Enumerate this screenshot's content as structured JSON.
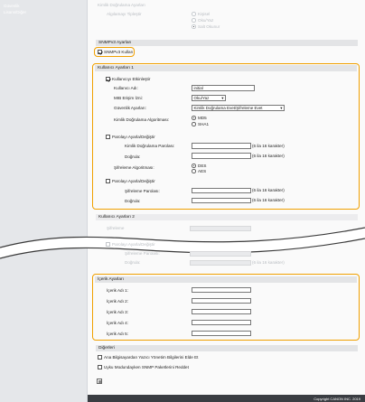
{
  "sidebar": {
    "items": [
      "Güvenlik",
      "Lisans/Diğer"
    ]
  },
  "top_faded": {
    "section": "Kimlik Doğrulama Ayarları",
    "row_label": "Algılamayı Tipleştir",
    "options": [
      "Kişisel",
      "Oku/Yaz",
      "Salt Okunur"
    ]
  },
  "snmpv3": {
    "header": "SNMPv3 Ayarları",
    "enable_label": "SNMPv3 Kullan",
    "enable_checked": true
  },
  "user1": {
    "header": "Kullanıcı Ayarları 1",
    "enable_label": "Kullanıcıyı Etkinleştir",
    "enable_checked": true,
    "username_label": "Kullanıcı Adı:",
    "username_value": "initial",
    "mib_label": "MIB Erişim İzni:",
    "mib_value": "Oku/Yaz",
    "security_label": "Güvenlik Ayarları:",
    "security_value": "Kimlik Doğrulama Evet/Şifreleme Evet",
    "auth_algo_label": "Kimlik Doğrulama Algoritması:",
    "auth_algo_options": [
      "MD5",
      "SHA1"
    ],
    "auth_algo_selected": 0,
    "set_pw_label": "Parolayı Ayarla/Değiştir",
    "auth_pw_label": "Kimlik Doğrulama Parolası:",
    "auth_pw_hint": "(6 ila 16 karakter)",
    "confirm_label": "Doğrula:",
    "confirm_hint": "(6 ila 16 karakter)",
    "enc_algo_label": "Şifreleme Algoritması:",
    "enc_algo_options": [
      "DES",
      "AES"
    ],
    "enc_algo_selected": 0,
    "set_pw2_label": "Parolayı Ayarla/Değiştir",
    "enc_pw_label": "Şifreleme Parolası:",
    "enc_pw_hint": "(6 ila 16 karakter)",
    "confirm2_label": "Doğrula:",
    "confirm2_hint": "(6 ila 16 karakter)"
  },
  "user2": {
    "header": "Kullanıcı Ayarları 2",
    "row1": "Şifreleme",
    "set_pw_label": "Parolayı Ayarla/Değiştir",
    "enc_pw_label": "Şifreleme Parolası:",
    "confirm_label": "Doğrula:",
    "confirm_hint": "(6 ila 16 karakter)"
  },
  "context": {
    "header": "İçerik Ayarları",
    "labels": [
      "İçerik Adı 1:",
      "İçerik Adı 2:",
      "İçerik Adı 3:",
      "İçerik Adı 4:",
      "İçerik Adı 5:"
    ]
  },
  "other": {
    "header": "Diğerleri",
    "opt1": "Ana Bilgisayardan Yazıcı Yönetim Bilgilerini Elde Et",
    "opt2": "Uyku Modundayken SNMP Paketlerini Reddet"
  },
  "footer": {
    "copyright": "Copyright CANON INC. 2019"
  },
  "colors": {
    "highlight": "#f0a000",
    "footer_bg": "#3a3d42",
    "section_bg": "#e3e4e6"
  }
}
